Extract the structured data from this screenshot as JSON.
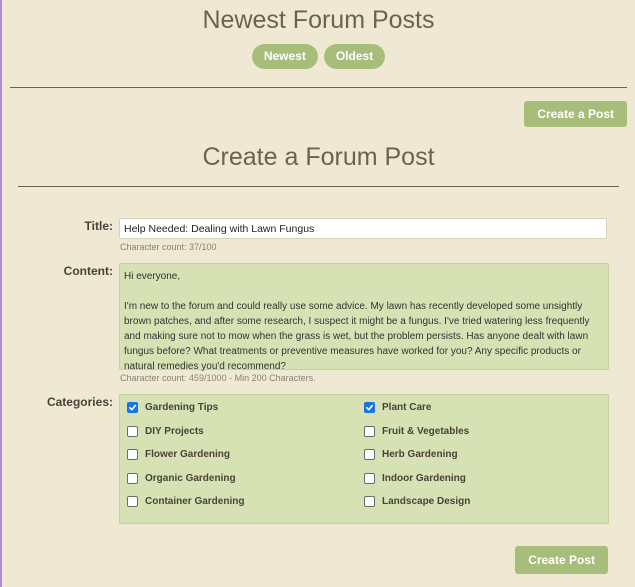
{
  "header": {
    "title": "Newest Forum Posts",
    "sort_newest": "Newest",
    "sort_oldest": "Oldest",
    "create_post_top": "Create a Post"
  },
  "form": {
    "title": "Create a Forum Post",
    "title_label": "Title:",
    "title_value": "Help Needed: Dealing with Lawn Fungus",
    "title_count": "Character count: 37/100",
    "content_label": "Content:",
    "content_value": "Hi everyone,\n\nI'm new to the forum and could really use some advice. My lawn has recently developed some unsightly brown patches, and after some research, I suspect it might be a fungus. I've tried watering less frequently and making sure not to mow when the grass is wet, but the problem persists. Has anyone dealt with lawn fungus before? What treatments or preventive measures have worked for you? Any specific products or natural remedies you'd recommend?",
    "content_count": "Character count: 459/1000 - Min 200 Characters.",
    "categories_label": "Categories:",
    "categories": [
      {
        "label": "Gardening Tips",
        "checked": true
      },
      {
        "label": "Plant Care",
        "checked": true
      },
      {
        "label": "DIY Projects",
        "checked": false
      },
      {
        "label": "Fruit & Vegetables",
        "checked": false
      },
      {
        "label": "Flower Gardening",
        "checked": false
      },
      {
        "label": "Herb Gardening",
        "checked": false
      },
      {
        "label": "Organic Gardening",
        "checked": false
      },
      {
        "label": "Indoor Gardening",
        "checked": false
      },
      {
        "label": "Container Gardening",
        "checked": false
      },
      {
        "label": "Landscape Design",
        "checked": false
      }
    ],
    "submit_label": "Create Post"
  },
  "colors": {
    "background": "#efe9d3",
    "accent": "#a8bd7a",
    "panel": "#d6e2b4",
    "checkbox_checked": "#1a73e8"
  }
}
